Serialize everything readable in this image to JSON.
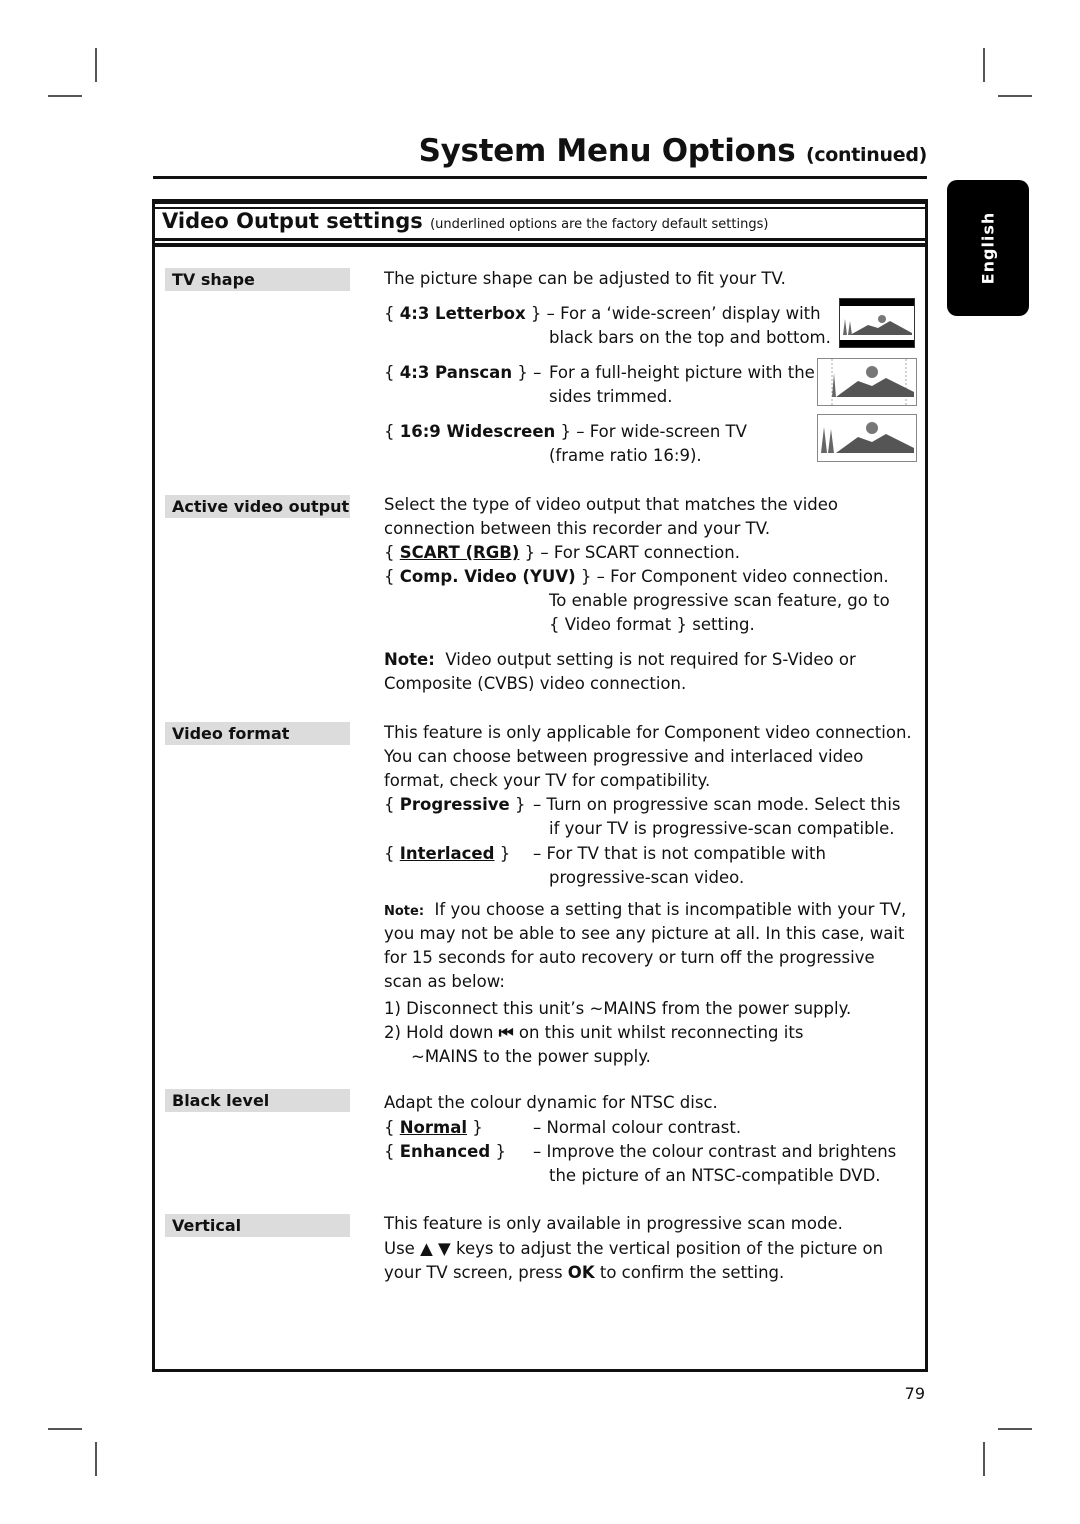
{
  "header": {
    "title": "System Menu Options",
    "title_suffix": "(continued)"
  },
  "side_tab": {
    "label": "English"
  },
  "section": {
    "title": "Video Output settings",
    "subtitle": "(underlined options are the factory default settings)"
  },
  "settings": {
    "tv_shape": {
      "label": "TV shape",
      "intro": "The picture shape can be adjusted to fit your TV.",
      "options": [
        {
          "name": "4:3 Letterbox",
          "dash": "– For a ‘wide-screen’ display with",
          "cont": "black bars on the top and bottom.",
          "icon": "letterbox-picture-icon"
        },
        {
          "name": "4:3 Panscan",
          "dash": "–",
          "desc": "For a full-height picture with the",
          "cont": "sides trimmed.",
          "icon": "panscan-picture-icon"
        },
        {
          "name": "16:9 Widescreen",
          "dash": "– For wide-screen TV",
          "cont": "(frame ratio 16:9).",
          "icon": "widescreen-picture-icon"
        }
      ]
    },
    "active_video_output": {
      "label": "Active video output",
      "intro1": "Select the type of video output that matches the video",
      "intro2": "connection between this recorder and your TV.",
      "opt1_name": "SCART (RGB)",
      "opt1_desc": "– For SCART connection.",
      "opt1_default": true,
      "opt2_name": "Comp. Video (YUV)",
      "opt2_desc": "– For Component video connection.",
      "opt2_cont1": "To enable progressive scan feature, go to",
      "opt2_cont2": "{ Video format } setting.",
      "note_label": "Note:",
      "note1": "Video output setting is not required for S-Video or",
      "note2": "Composite (CVBS) video connection."
    },
    "video_format": {
      "label": "Video format",
      "intro1": "This feature is only applicable for Component video connection.",
      "intro2": "You can choose between progressive and interlaced video",
      "intro3": "format, check your TV for compatibility.",
      "opt1_name": "Progressive",
      "opt1_desc": "– Turn on progressive scan mode.  Select this",
      "opt1_cont": "if your TV is progressive-scan compatible.",
      "opt2_name": "Interlaced",
      "opt2_desc": "– For TV that is not compatible with",
      "opt2_cont": "progressive-scan video.",
      "opt2_default": true,
      "note_label": "Note:",
      "note1": "If you choose a setting that is incompatible with your TV,",
      "note2": "you may not be able to see any picture at all.  In this case, wait",
      "note3": "for 15 seconds for auto recovery or turn off the progressive",
      "note4": "scan as below:",
      "step1": "1)  Disconnect this unit’s ~MAINS from the power supply.",
      "step2_a": "2)  Hold down",
      "step2_icon": "⏮",
      "step2_b": "on this unit whilst reconnecting its",
      "step2_cont": "~MAINS to the power supply."
    },
    "black_level": {
      "label": "Black level",
      "intro": "Adapt the colour dynamic for NTSC disc.",
      "opt1_name": "Normal",
      "opt1_desc": "– Normal colour contrast.",
      "opt1_default": true,
      "opt2_name": "Enhanced",
      "opt2_desc": "– Improve the colour contrast and brightens",
      "opt2_cont": "the picture of an NTSC-compatible DVD."
    },
    "vertical": {
      "label": "Vertical",
      "line1": "This feature is only available in progressive scan mode.",
      "line2_a": "Use",
      "up_arrow": "▲",
      "down_arrow": "▼",
      "line2_b": "keys to adjust the vertical position of the picture on",
      "line3_a": "your TV screen, press",
      "ok_key": "OK",
      "line3_b": "to confirm the setting."
    }
  },
  "braces": {
    "open": "{",
    "close": "}"
  },
  "page_number": "79"
}
